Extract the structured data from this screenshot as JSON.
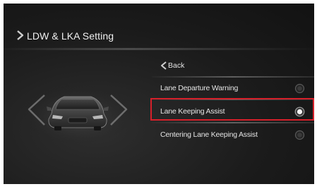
{
  "header": {
    "title": "LDW & LKA Setting"
  },
  "menu": {
    "back_label": "Back",
    "items": [
      {
        "label": "Lane Departure Warning",
        "selected": false
      },
      {
        "label": "Lane Keeping Assist",
        "selected": true
      },
      {
        "label": "Centering Lane Keeping Assist",
        "selected": false
      }
    ]
  },
  "colors": {
    "highlight": "#d6202a",
    "background": "#1b1b1b",
    "text": "#e4e4e4"
  },
  "icons": {
    "header": "chevron-right-icon",
    "back": "chevron-left-icon",
    "vehicle": "car-front-icon",
    "radio": "radio-button-icon"
  }
}
